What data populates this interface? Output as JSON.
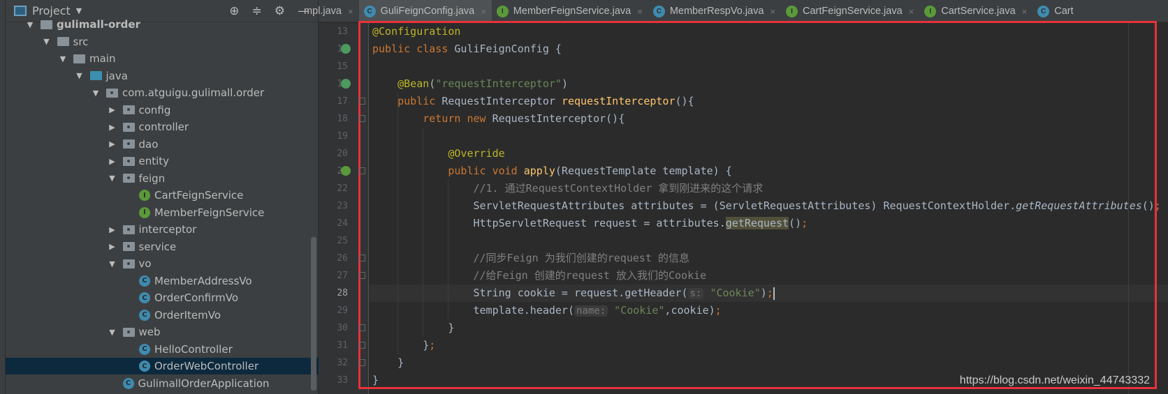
{
  "sidebar": {
    "title": "Project",
    "tree": [
      {
        "label": "gulimall-order",
        "depth": 0,
        "kind": "module",
        "open": true,
        "bold": true
      },
      {
        "label": "src",
        "depth": 1,
        "kind": "folder",
        "open": true
      },
      {
        "label": "main",
        "depth": 2,
        "kind": "folder",
        "open": true
      },
      {
        "label": "java",
        "depth": 3,
        "kind": "src",
        "open": true
      },
      {
        "label": "com.atguigu.gulimall.order",
        "depth": 4,
        "kind": "pkg",
        "open": true
      },
      {
        "label": "config",
        "depth": 5,
        "kind": "pkg",
        "open": false
      },
      {
        "label": "controller",
        "depth": 5,
        "kind": "pkg",
        "open": false
      },
      {
        "label": "dao",
        "depth": 5,
        "kind": "pkg",
        "open": false
      },
      {
        "label": "entity",
        "depth": 5,
        "kind": "pkg",
        "open": false
      },
      {
        "label": "feign",
        "depth": 5,
        "kind": "pkg",
        "open": true
      },
      {
        "label": "CartFeignService",
        "depth": 6,
        "kind": "interface"
      },
      {
        "label": "MemberFeignService",
        "depth": 6,
        "kind": "interface"
      },
      {
        "label": "interceptor",
        "depth": 5,
        "kind": "pkg",
        "open": false
      },
      {
        "label": "service",
        "depth": 5,
        "kind": "pkg",
        "open": false
      },
      {
        "label": "vo",
        "depth": 5,
        "kind": "pkg",
        "open": true
      },
      {
        "label": "MemberAddressVo",
        "depth": 6,
        "kind": "class"
      },
      {
        "label": "OrderConfirmVo",
        "depth": 6,
        "kind": "class"
      },
      {
        "label": "OrderItemVo",
        "depth": 6,
        "kind": "class"
      },
      {
        "label": "web",
        "depth": 5,
        "kind": "pkg",
        "open": true
      },
      {
        "label": "HelloController",
        "depth": 6,
        "kind": "class"
      },
      {
        "label": "OrderWebController",
        "depth": 6,
        "kind": "class",
        "selected": true
      },
      {
        "label": "GulimallOrderApplication",
        "depth": 5,
        "kind": "class"
      }
    ]
  },
  "tabs": [
    {
      "label": "mpl.java",
      "kind": "none"
    },
    {
      "label": "GuliFeignConfig.java",
      "kind": "class",
      "active": true
    },
    {
      "label": "MemberFeignService.java",
      "kind": "interface"
    },
    {
      "label": "MemberRespVo.java",
      "kind": "class"
    },
    {
      "label": "CartFeignService.java",
      "kind": "interface"
    },
    {
      "label": "CartService.java",
      "kind": "interface"
    },
    {
      "label": "Cart",
      "kind": "class"
    }
  ],
  "editor": {
    "current_line": 28,
    "lines": [
      {
        "n": 13,
        "t": [
          [
            "@Configuration",
            "an"
          ]
        ]
      },
      {
        "n": 14,
        "t": [
          [
            "public class ",
            "kw"
          ],
          [
            "GuliFeignConfig",
            ""
          ],
          [
            " {",
            ""
          ]
        ]
      },
      {
        "n": 15,
        "t": []
      },
      {
        "n": 16,
        "t": [
          [
            "    @Bean",
            "an"
          ],
          [
            "(",
            ""
          ],
          [
            "\"requestInterceptor\"",
            "st"
          ],
          [
            ")",
            ""
          ]
        ]
      },
      {
        "n": 17,
        "t": [
          [
            "    public ",
            "kw"
          ],
          [
            "RequestInterceptor ",
            ""
          ],
          [
            "requestInterceptor",
            "md"
          ],
          [
            "(){",
            ""
          ]
        ]
      },
      {
        "n": 18,
        "t": [
          [
            "        return new ",
            "kw"
          ],
          [
            "RequestInterceptor(){",
            ""
          ]
        ]
      },
      {
        "n": 19,
        "t": []
      },
      {
        "n": 20,
        "t": [
          [
            "            @Override",
            "an"
          ]
        ]
      },
      {
        "n": 21,
        "t": [
          [
            "            public void ",
            "kw"
          ],
          [
            "apply",
            "md"
          ],
          [
            "(RequestTemplate template) {",
            ""
          ]
        ]
      },
      {
        "n": 22,
        "t": [
          [
            "                //1. 通过RequestContextHolder 拿到刚进来的这个请求",
            "cm"
          ]
        ]
      },
      {
        "n": 23,
        "t": [
          [
            "                ServletRequestAttributes attributes = (ServletRequestAttributes) RequestContextHolder.",
            ""
          ],
          [
            "getRequestAttributes",
            "it"
          ],
          [
            "()",
            ""
          ],
          [
            ";",
            "kw"
          ]
        ]
      },
      {
        "n": 24,
        "t": [
          [
            "                HttpServletRequest request = attributes.",
            ""
          ],
          [
            "getRequest",
            "hl"
          ],
          [
            "()",
            ""
          ],
          [
            ";",
            "kw"
          ]
        ]
      },
      {
        "n": 25,
        "t": []
      },
      {
        "n": 26,
        "t": [
          [
            "                //同步Feign 为我们创建的request 的信息",
            "cm"
          ]
        ]
      },
      {
        "n": 27,
        "t": [
          [
            "                //给Feign 创建的request 放入我们的Cookie",
            "cm"
          ]
        ]
      },
      {
        "n": 28,
        "t": [
          [
            "                String cookie = request.getHeader(",
            ""
          ],
          [
            "s:",
            "hint"
          ],
          [
            " ",
            ""
          ],
          [
            "\"Cookie\"",
            "st"
          ],
          [
            ")",
            ""
          ],
          [
            ";",
            "kw"
          ]
        ]
      },
      {
        "n": 29,
        "t": [
          [
            "                template.header(",
            ""
          ],
          [
            "name:",
            "hint"
          ],
          [
            " ",
            ""
          ],
          [
            "\"Cookie\"",
            "st"
          ],
          [
            ",cookie)",
            ""
          ],
          [
            ";",
            "kw"
          ]
        ]
      },
      {
        "n": 30,
        "t": [
          [
            "            }",
            ""
          ]
        ]
      },
      {
        "n": 31,
        "t": [
          [
            "        }",
            ""
          ],
          [
            ";",
            "kw"
          ]
        ]
      },
      {
        "n": 32,
        "t": [
          [
            "    }",
            ""
          ]
        ]
      },
      {
        "n": 33,
        "t": [
          [
            "}",
            ""
          ]
        ]
      }
    ]
  },
  "watermark": "https://blog.csdn.net/weixin_44743332",
  "colors": {
    "highlight_box": "#e8323a",
    "accent": "#4a88c7"
  }
}
